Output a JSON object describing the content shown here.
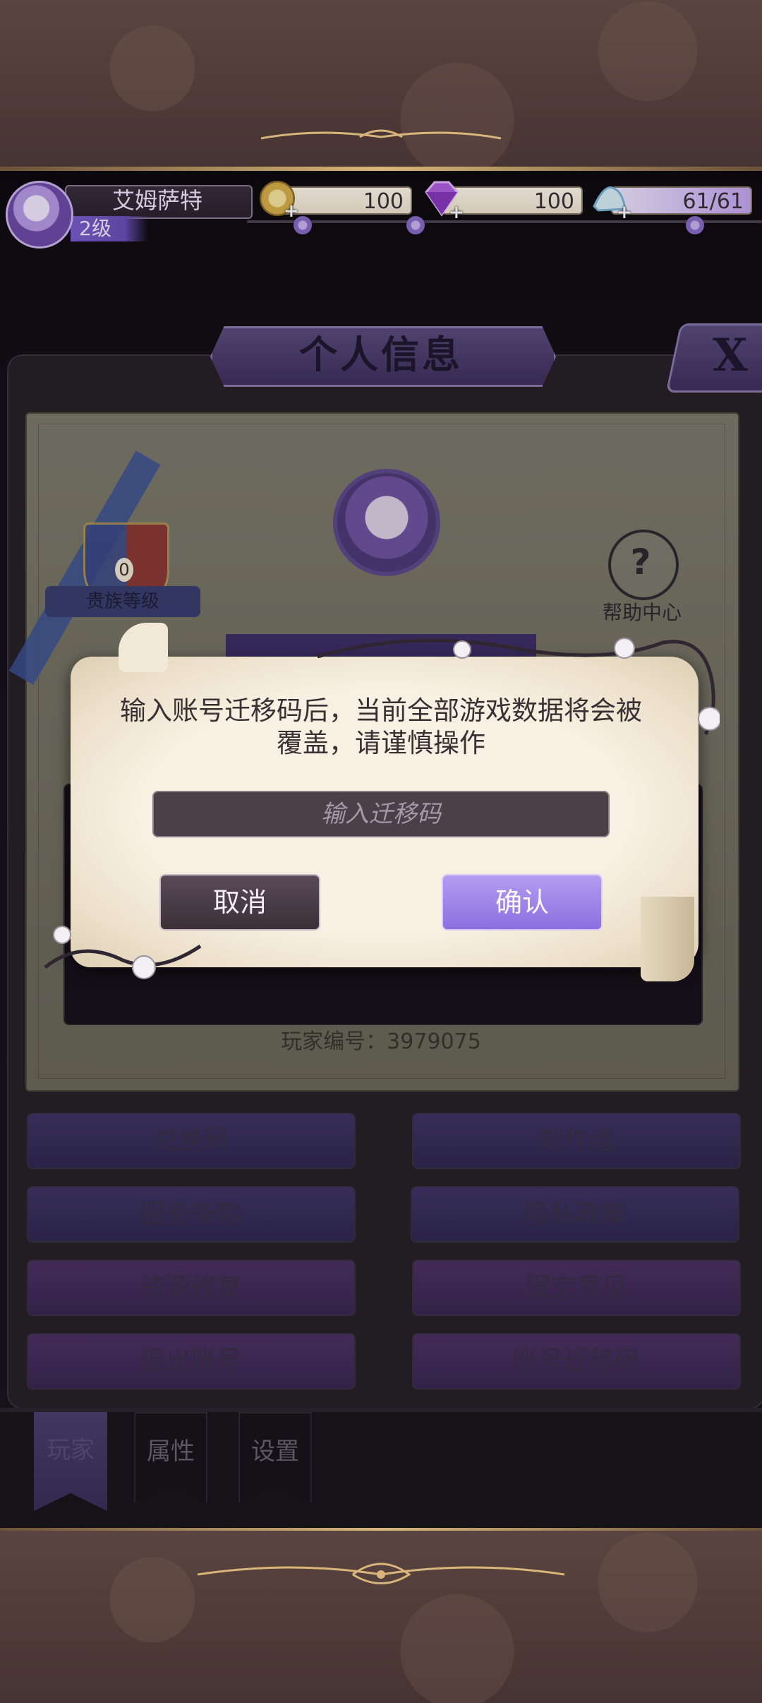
{
  "header": {
    "player_name": "艾姆萨特",
    "level": "2级",
    "gold": "100",
    "gems": "100",
    "stamina": "61/61",
    "gold_icon": "crown-coin-icon",
    "gem_icon": "purple-gem-icon",
    "stamina_icon": "glass-slipper-icon",
    "plus": "+"
  },
  "page": {
    "title": "个人信息",
    "close": "X"
  },
  "card": {
    "noble_badge_number": "0",
    "noble_label": "贵族等级",
    "help_label": "帮助中心",
    "help_glyph": "?",
    "player_id": "玩家编号：3979075"
  },
  "menu": {
    "buttons": [
      {
        "label": "兑换码"
      },
      {
        "label": "制作组"
      },
      {
        "label": "服务条款"
      },
      {
        "label": "隐私政策"
      },
      {
        "label": "资源修复"
      },
      {
        "label": "提交意见"
      },
      {
        "label": "退出账号"
      },
      {
        "label": "账号迁移码"
      }
    ]
  },
  "tabs": [
    {
      "label": "玩家",
      "active": true
    },
    {
      "label": "属性",
      "active": false
    },
    {
      "label": "设置",
      "active": false
    }
  ],
  "dialog": {
    "message_line1": "输入账号迁移码后，当前全部游戏数据将会被",
    "message_line2": "覆盖，请谨慎操作",
    "input_placeholder": "输入迁移码",
    "input_value": "",
    "cancel_label": "取消",
    "confirm_label": "确认"
  },
  "colors": {
    "accent_purple": "#8c6fe0",
    "wood": "#5a4440",
    "gold_trim": "#d8b57a"
  }
}
